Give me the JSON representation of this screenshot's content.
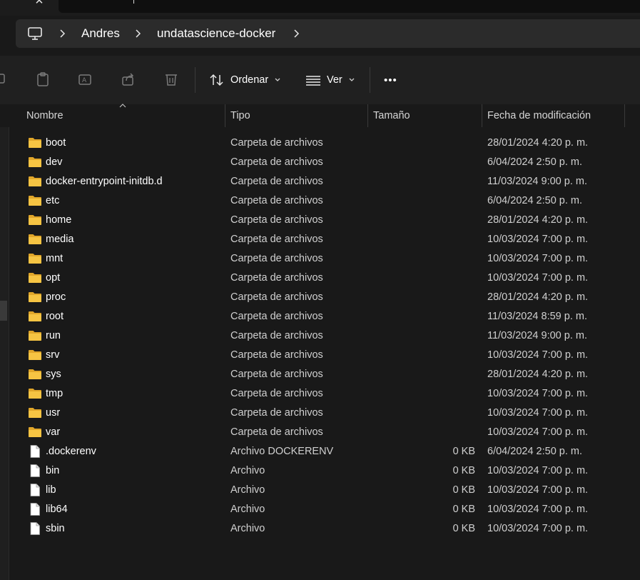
{
  "breadcrumb": [
    "Andres",
    "undatascience-docker"
  ],
  "command_bar": {
    "sort_label": "Ordenar",
    "view_label": "Ver",
    "more_label": "•••"
  },
  "columns": {
    "name": "Nombre",
    "type": "Tipo",
    "size": "Tamaño",
    "date": "Fecha de modificación"
  },
  "colors": {
    "folder": "#f6c443",
    "background": "#191919",
    "text": "#ffffff"
  },
  "files": [
    {
      "icon": "folder-icon",
      "name": "boot",
      "type": "Carpeta de archivos",
      "size": "",
      "date": "28/01/2024 4:20 p. m."
    },
    {
      "icon": "folder-icon",
      "name": "dev",
      "type": "Carpeta de archivos",
      "size": "",
      "date": "6/04/2024 2:50 p. m."
    },
    {
      "icon": "folder-icon",
      "name": "docker-entrypoint-initdb.d",
      "type": "Carpeta de archivos",
      "size": "",
      "date": "11/03/2024 9:00 p. m."
    },
    {
      "icon": "folder-icon",
      "name": "etc",
      "type": "Carpeta de archivos",
      "size": "",
      "date": "6/04/2024 2:50 p. m."
    },
    {
      "icon": "folder-icon",
      "name": "home",
      "type": "Carpeta de archivos",
      "size": "",
      "date": "28/01/2024 4:20 p. m."
    },
    {
      "icon": "folder-icon",
      "name": "media",
      "type": "Carpeta de archivos",
      "size": "",
      "date": "10/03/2024 7:00 p. m."
    },
    {
      "icon": "folder-icon",
      "name": "mnt",
      "type": "Carpeta de archivos",
      "size": "",
      "date": "10/03/2024 7:00 p. m."
    },
    {
      "icon": "folder-icon",
      "name": "opt",
      "type": "Carpeta de archivos",
      "size": "",
      "date": "10/03/2024 7:00 p. m."
    },
    {
      "icon": "folder-icon",
      "name": "proc",
      "type": "Carpeta de archivos",
      "size": "",
      "date": "28/01/2024 4:20 p. m."
    },
    {
      "icon": "folder-icon",
      "name": "root",
      "type": "Carpeta de archivos",
      "size": "",
      "date": "11/03/2024 8:59 p. m."
    },
    {
      "icon": "folder-icon",
      "name": "run",
      "type": "Carpeta de archivos",
      "size": "",
      "date": "11/03/2024 9:00 p. m."
    },
    {
      "icon": "folder-icon",
      "name": "srv",
      "type": "Carpeta de archivos",
      "size": "",
      "date": "10/03/2024 7:00 p. m."
    },
    {
      "icon": "folder-icon",
      "name": "sys",
      "type": "Carpeta de archivos",
      "size": "",
      "date": "28/01/2024 4:20 p. m."
    },
    {
      "icon": "folder-icon",
      "name": "tmp",
      "type": "Carpeta de archivos",
      "size": "",
      "date": "10/03/2024 7:00 p. m."
    },
    {
      "icon": "folder-icon",
      "name": "usr",
      "type": "Carpeta de archivos",
      "size": "",
      "date": "10/03/2024 7:00 p. m."
    },
    {
      "icon": "folder-icon",
      "name": "var",
      "type": "Carpeta de archivos",
      "size": "",
      "date": "10/03/2024 7:00 p. m."
    },
    {
      "icon": "file-icon",
      "name": ".dockerenv",
      "type": "Archivo DOCKERENV",
      "size": "0 KB",
      "date": "6/04/2024 2:50 p. m."
    },
    {
      "icon": "file-icon",
      "name": "bin",
      "type": "Archivo",
      "size": "0 KB",
      "date": "10/03/2024 7:00 p. m."
    },
    {
      "icon": "file-icon",
      "name": "lib",
      "type": "Archivo",
      "size": "0 KB",
      "date": "10/03/2024 7:00 p. m."
    },
    {
      "icon": "file-icon",
      "name": "lib64",
      "type": "Archivo",
      "size": "0 KB",
      "date": "10/03/2024 7:00 p. m."
    },
    {
      "icon": "file-icon",
      "name": "sbin",
      "type": "Archivo",
      "size": "0 KB",
      "date": "10/03/2024 7:00 p. m."
    }
  ]
}
